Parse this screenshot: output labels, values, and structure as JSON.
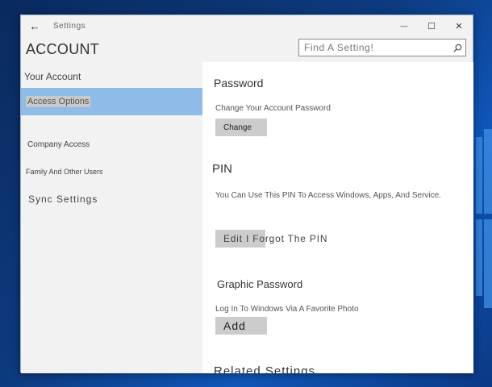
{
  "window": {
    "title": "Settings",
    "back_glyph": "←",
    "minimize_glyph": "—",
    "maximize_glyph": "☐",
    "close_glyph": "✕"
  },
  "header": {
    "title": "ACCOUNT",
    "search_placeholder": "Find A Setting!"
  },
  "sidebar": {
    "items": [
      {
        "label": "Your Account"
      },
      {
        "label": "Access Options",
        "selected": true
      },
      {
        "label": "Company Access"
      },
      {
        "label": "Family And Other Users"
      },
      {
        "label": "Sync Settings"
      }
    ]
  },
  "content": {
    "password": {
      "title": "Password",
      "description": "Change Your Account Password",
      "button": "Change"
    },
    "pin": {
      "title": "PIN",
      "description": "You Can Use This PIN To Access Windows, Apps, And Service.",
      "button": "Edit I Forgot The PIN"
    },
    "graphic": {
      "title": "Graphic Password",
      "description": "Log In To Windows Via A Favorite Photo",
      "button": "Add"
    },
    "related": {
      "title": "Related Settings"
    }
  },
  "colors": {
    "selected_nav": "#8ebbe8",
    "button_bg": "#cccccc",
    "desktop": "#0d3b80"
  },
  "icons": [
    "back-arrow-icon",
    "minimize-icon",
    "maximize-icon",
    "close-icon",
    "search-icon"
  ]
}
